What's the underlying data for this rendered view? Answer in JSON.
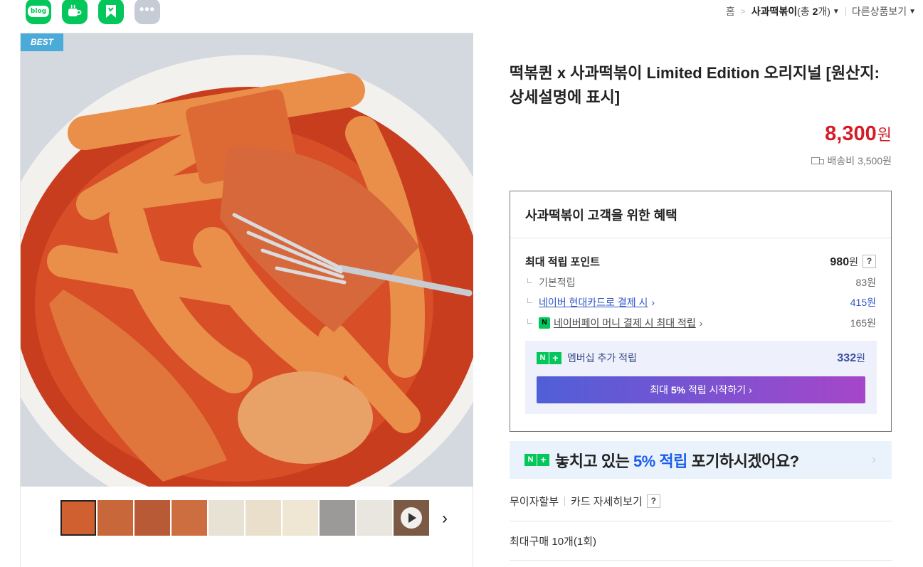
{
  "share_icons": [
    {
      "name": "blog",
      "label": "blog",
      "color": "#03c75a"
    },
    {
      "name": "cafe",
      "color": "#03c75a"
    },
    {
      "name": "bookmark",
      "color": "#03c75a"
    },
    {
      "name": "more",
      "label": "•••",
      "color": "#c5ccd6"
    }
  ],
  "breadcrumb": {
    "home": "홈",
    "separator": ">",
    "current": "사과떡볶이",
    "count": "(총 2개)",
    "count_prefix": "(총 ",
    "count_num": "2",
    "count_suffix": "개)",
    "other": "다른상품보기"
  },
  "gallery": {
    "badge": "BEST",
    "thumb_count": 10,
    "next": "›"
  },
  "product": {
    "title": "떡볶퀸 x 사과떡볶이 Limited Edition 오리지널 [원산지:상세설명에 표시]",
    "price": "8,300",
    "price_unit": "원",
    "shipping": "배송비 3,500원"
  },
  "benefit": {
    "heading": "사과떡볶이 고객을 위한 혜택",
    "max_points_label": "최대 적립 포인트",
    "max_points_value": "980",
    "unit": "원",
    "help": "?",
    "basic_label": "기본적립",
    "basic_value": "83원",
    "card_label": "네이버 현대카드로 결제 시",
    "card_value": "415원",
    "npay_label": "네이버페이 머니 결제 시 최대 적립",
    "npay_value": "165원",
    "npay_badge": "N",
    "arrow": "›",
    "membership_label": "멤버십 추가 적립",
    "membership_value": "332",
    "membership_button_pre": "최대 ",
    "membership_button_bold": "5%",
    "membership_button_post": " 적립 시작하기 ›"
  },
  "banner": {
    "pre": "놓치고 있는 ",
    "highlight": "5% 적립",
    "post": " 포기하시겠어요?",
    "arrow": "›"
  },
  "options": {
    "installment": "무이자할부",
    "card_detail": "카드 자세히보기",
    "help": "?",
    "max_purchase": "최대구매 10개(1회)"
  }
}
